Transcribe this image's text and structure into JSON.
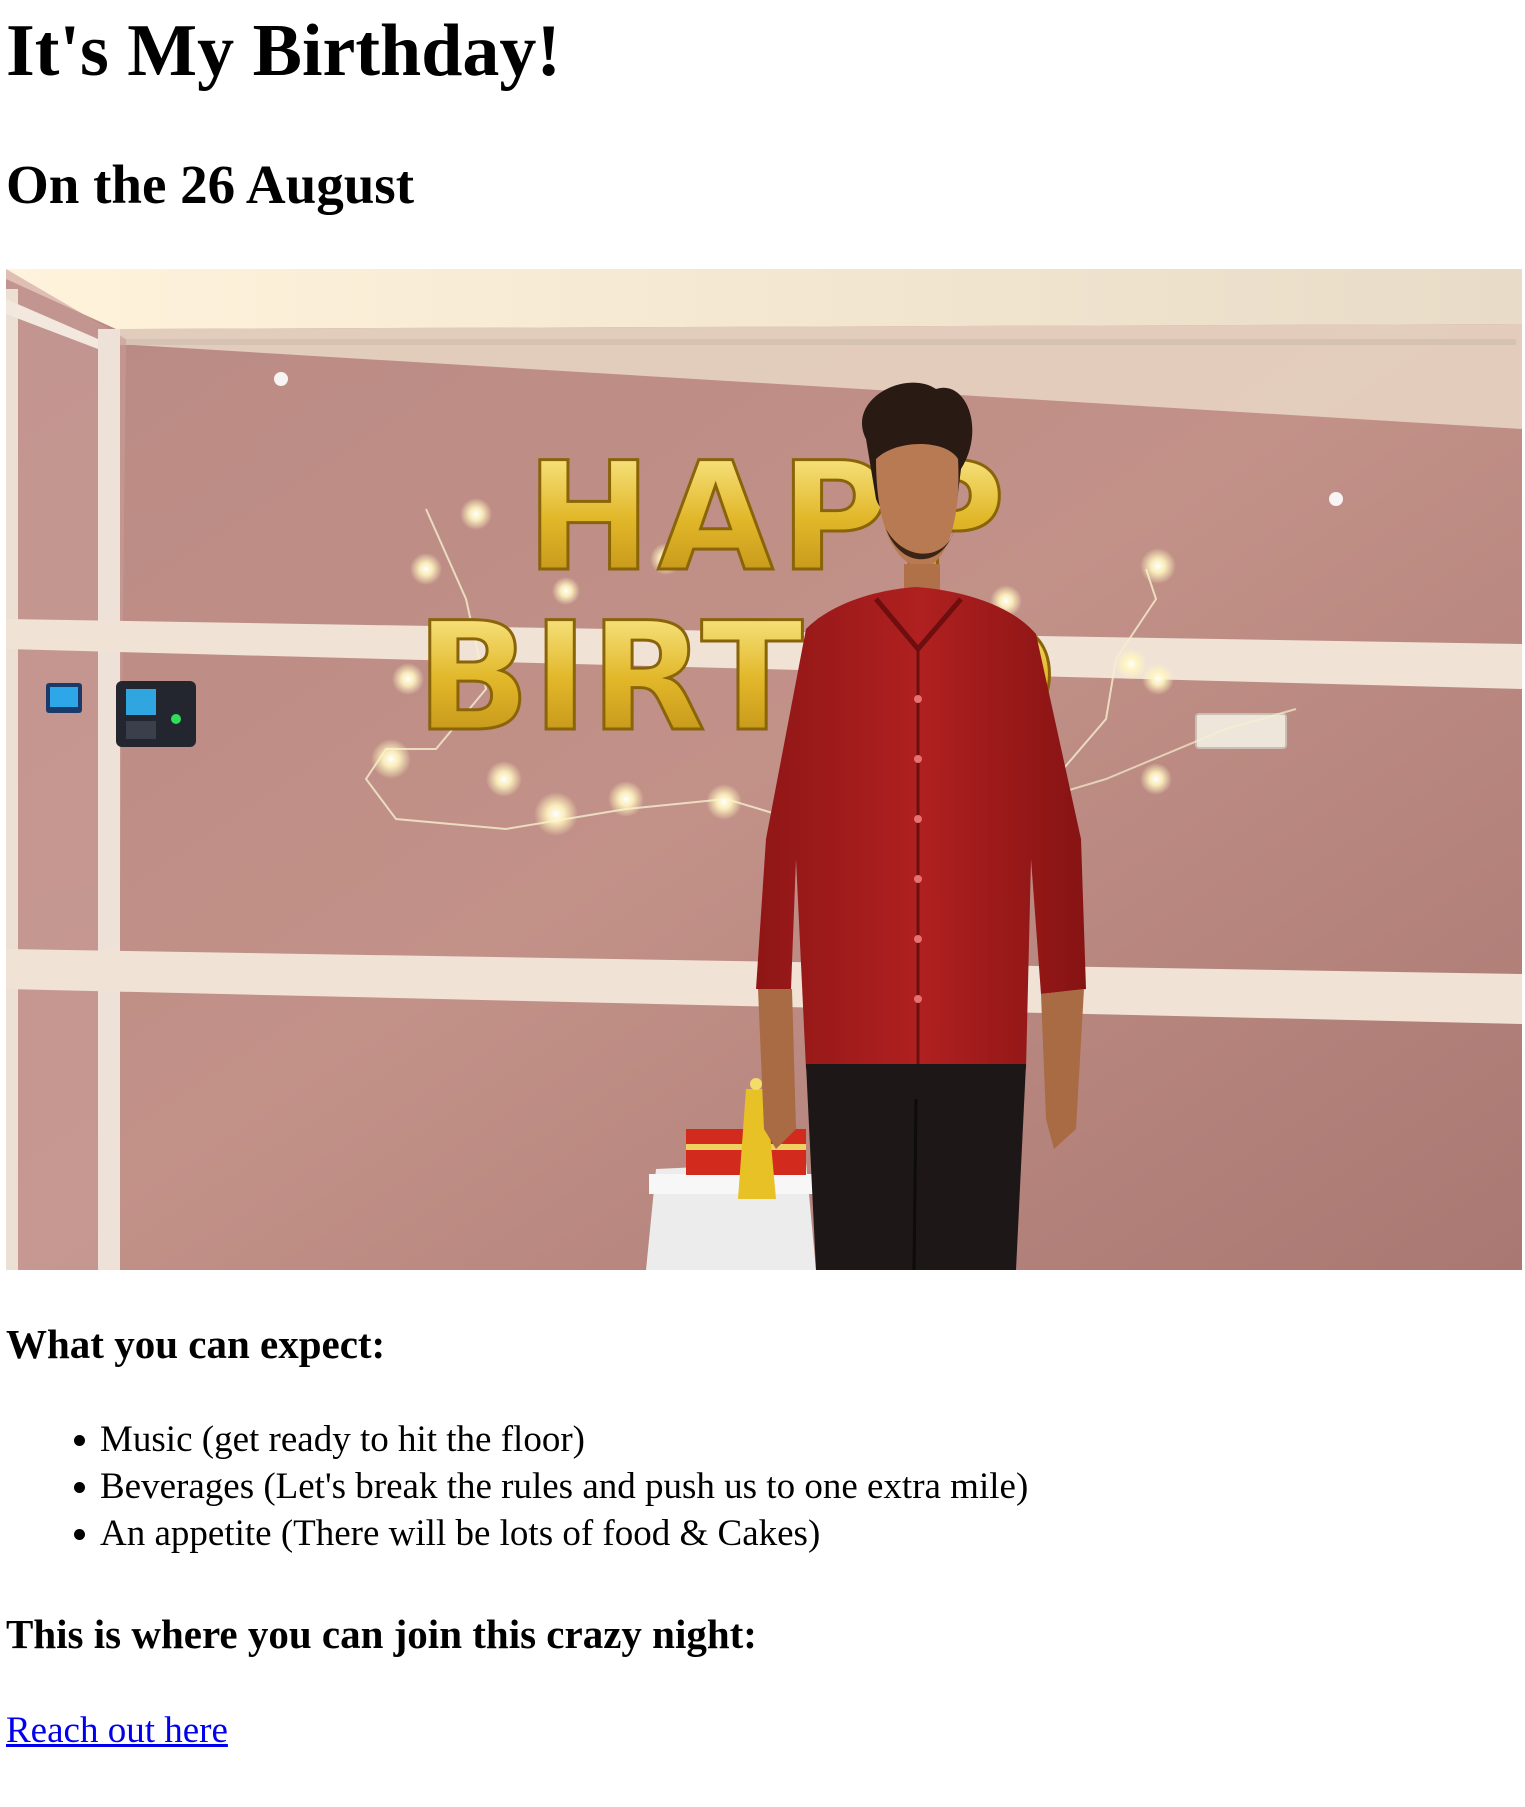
{
  "page": {
    "title": "It's My Birthday!",
    "subtitle": "On the 26 August"
  },
  "photo": {
    "alt": "Birthday photo",
    "balloon_text_top": "HAPP",
    "balloon_text_bottom": "BIRTHD"
  },
  "expect": {
    "heading": "What you can expect:",
    "items": [
      "Music (get ready to hit the floor)",
      "Beverages (Let's break the rules and push us to one extra mile)",
      "An appetite (There will be lots of food & Cakes)"
    ]
  },
  "join": {
    "heading": "This is where you can join this crazy night:",
    "link_text": "Reach out here"
  },
  "colors": {
    "link": "#0000ee",
    "text": "#000000",
    "background": "#ffffff"
  }
}
